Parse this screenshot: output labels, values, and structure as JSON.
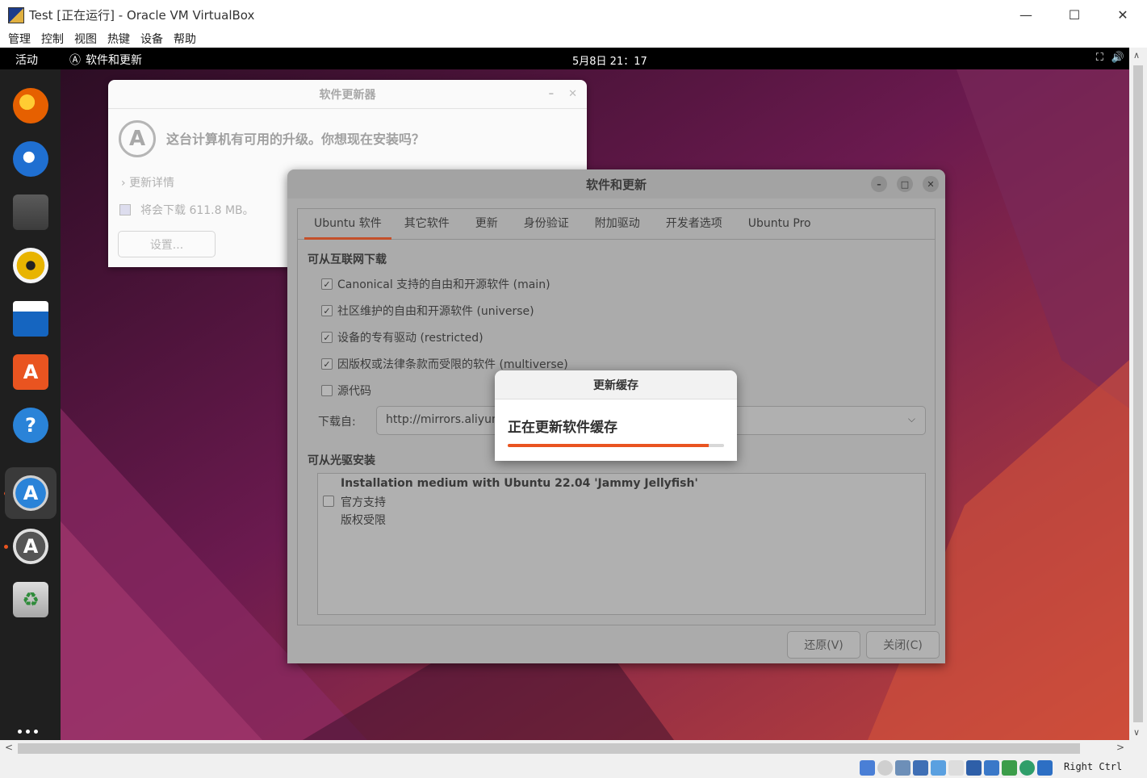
{
  "host": {
    "title": "Test [正在运行] - Oracle VM VirtualBox",
    "controls": {
      "minimize": "—",
      "maximize": "☐",
      "close": "✕"
    },
    "menu": [
      "管理",
      "控制",
      "视图",
      "热键",
      "设备",
      "帮助"
    ],
    "status": {
      "host_key": "Right Ctrl"
    }
  },
  "topbar": {
    "activities": "活动",
    "app_name": "软件和更新",
    "clock": "5月8日  21：17",
    "network_glyph": "⛶",
    "volume_glyph": "🔊"
  },
  "dock": {
    "items": [
      {
        "name": "firefox-icon",
        "color": "#e66000"
      },
      {
        "name": "thunderbird-icon",
        "color": "#1f6fd1"
      },
      {
        "name": "files-icon",
        "color": "#6b6b6b"
      },
      {
        "name": "rhythmbox-icon",
        "color": "#e8b400"
      },
      {
        "name": "libreoffice-writer-icon",
        "color": "#1565c0"
      },
      {
        "name": "app-center-icon",
        "color": "#e95420"
      },
      {
        "name": "help-icon",
        "color": "#2a83d8"
      },
      {
        "name": "software-updates-icon",
        "color": "#2a83d8"
      },
      {
        "name": "software-updater-icon",
        "color": "#555555"
      },
      {
        "name": "trash-icon",
        "color": "#9e9e9e"
      }
    ]
  },
  "updater": {
    "title": "软件更新器",
    "question": "这台计算机有可用的升级。你想现在安装吗？",
    "details": "更新详情",
    "download": "将会下载 611.8 MB。",
    "settings_button": "设置..."
  },
  "software": {
    "title": "软件和更新",
    "tabs": [
      "Ubuntu 软件",
      "其它软件",
      "更新",
      "身份验证",
      "附加驱动",
      "开发者选项",
      "Ubuntu Pro"
    ],
    "internet_section": "可从互联网下载",
    "sources": [
      {
        "label": "Canonical 支持的自由和开源软件 (main)",
        "checked": true
      },
      {
        "label": "社区维护的自由和开源软件 (universe)",
        "checked": true
      },
      {
        "label": "设备的专有驱动 (restricted)",
        "checked": true
      },
      {
        "label": "因版权或法律条款而受限的软件 (multiverse)",
        "checked": true
      },
      {
        "label": "源代码",
        "checked": false
      }
    ],
    "download_from_label": "下载自:",
    "download_from_value": "http://mirrors.aliyun",
    "cdrom_section": "可从光驱安装",
    "cdrom": {
      "title": "Installation medium with Ubuntu 22.04 'Jammy Jellyfish'",
      "line1": "官方支持",
      "line2": "版权受限"
    },
    "revert_button": "还原(V)",
    "close_button": "关闭(C)"
  },
  "cache_dialog": {
    "title": "更新缓存",
    "message": "正在更新软件缓存",
    "progress": 0.93,
    "accent": "#e95420"
  }
}
